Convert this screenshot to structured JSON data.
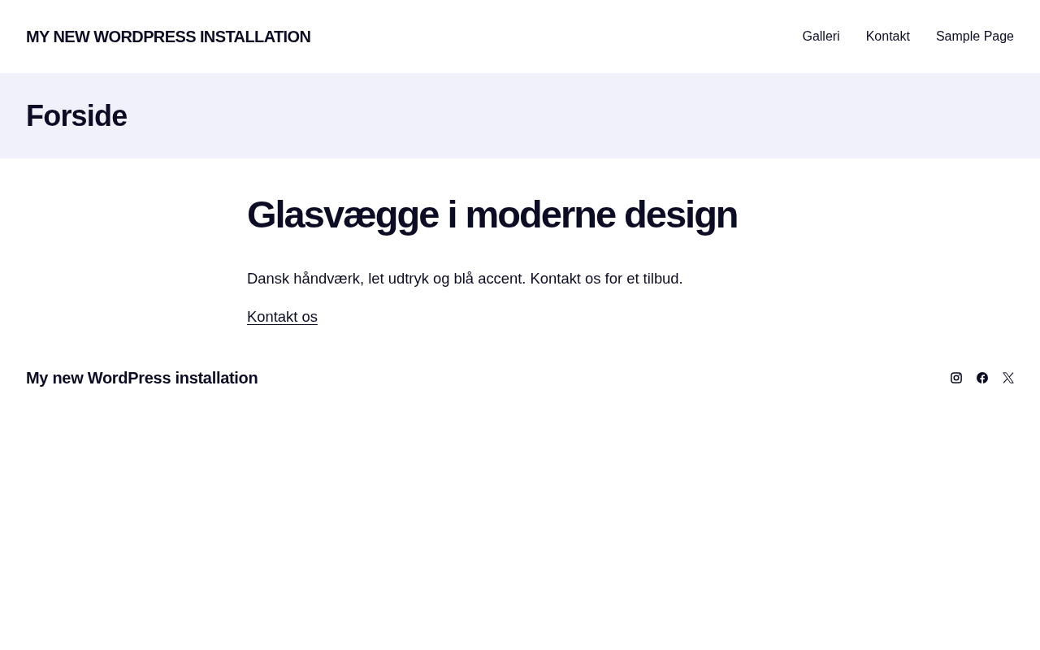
{
  "header": {
    "site_title": "MY NEW WORDPRESS INSTALLATION",
    "nav": [
      {
        "label": "Galleri"
      },
      {
        "label": "Kontakt"
      },
      {
        "label": "Sample Page"
      }
    ]
  },
  "page_banner": {
    "title": "Forside"
  },
  "content": {
    "heading": "Glasvægge i moderne design",
    "paragraph": "Dansk håndværk, let udtryk og blå accent. Kontakt os for et tilbud.",
    "link": "Kontakt os"
  },
  "footer": {
    "site_title": "My new WordPress installation",
    "social_links": [
      {
        "kind": "camera"
      },
      {
        "kind": "f-circle"
      },
      {
        "kind": "x-mark"
      }
    ]
  }
}
